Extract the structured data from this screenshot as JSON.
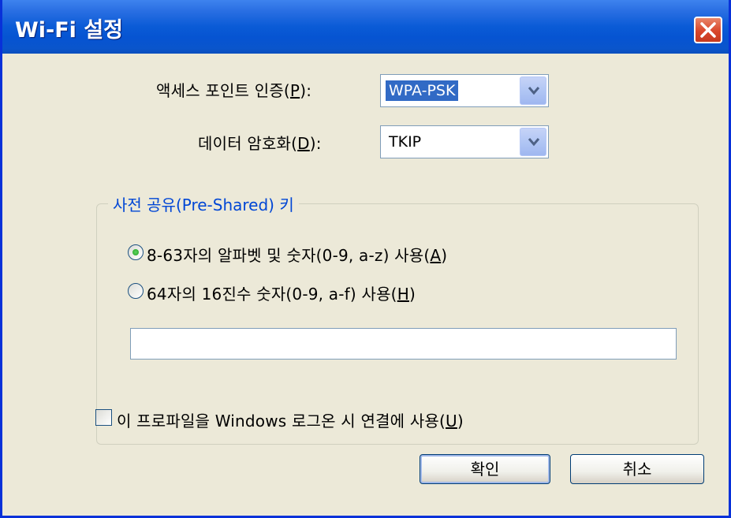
{
  "window": {
    "title": "Wi-Fi 설정",
    "close_icon": "close-x-icon"
  },
  "auth": {
    "label_prefix": "액세스 포인트 인증(",
    "label_mnemonic": "P",
    "label_suffix": "):",
    "value": "WPA-PSK"
  },
  "encryption": {
    "label_prefix": "데이터 암호화(",
    "label_mnemonic": "D",
    "label_suffix": "):",
    "value": "TKIP"
  },
  "psk_group": {
    "title": "사전 공유(Pre-Shared) 키",
    "option_ascii": {
      "label_prefix": "8-63자의 알파벳 및 숫자(0-9, a-z) 사용(",
      "label_mnemonic": "A",
      "label_suffix": ")",
      "selected": true
    },
    "option_hex": {
      "label_prefix": "64자의 16진수 숫자(0-9, a-f) 사용(",
      "label_mnemonic": "H",
      "label_suffix": ")",
      "selected": false
    },
    "key_value": ""
  },
  "logon": {
    "label_prefix": "이 프로파일을 Windows 로그온 시 연결에 사용(",
    "label_mnemonic": "U",
    "label_suffix": ")",
    "checked": false
  },
  "buttons": {
    "ok": "확인",
    "cancel": "취소"
  },
  "colors": {
    "title_bar": "#0a5bd6",
    "close_button": "#d9472b",
    "group_title": "#0046d5",
    "selection": "#316ac5"
  }
}
